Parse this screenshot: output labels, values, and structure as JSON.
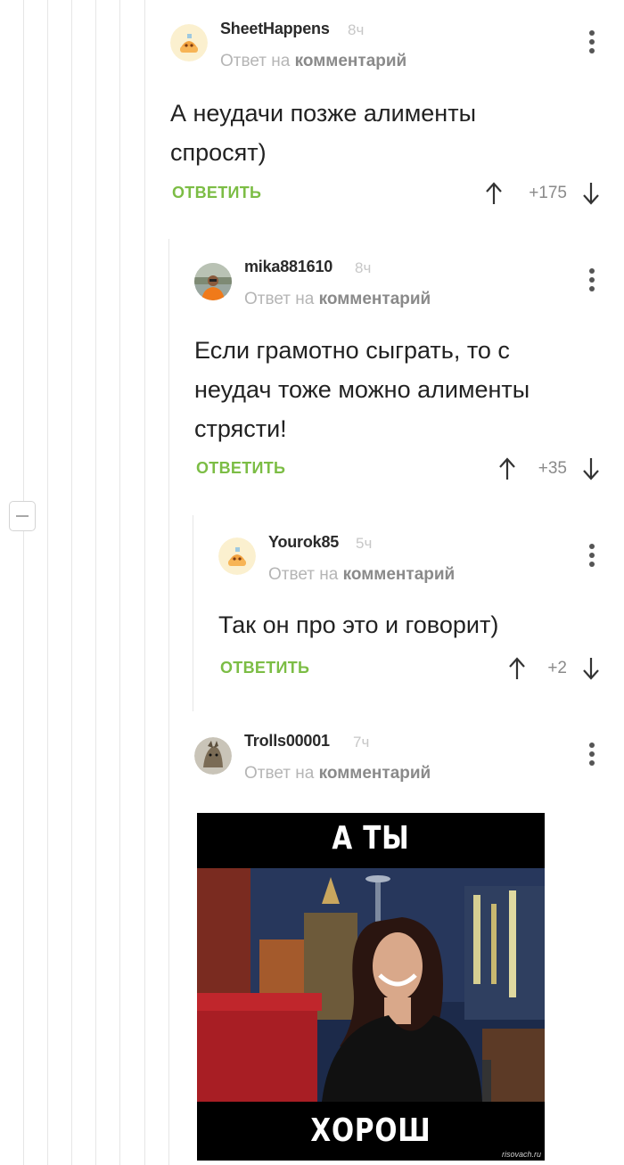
{
  "reply_label": "Ответ на",
  "reply_target": "комментарий",
  "reply_button": "ОТВЕТИТЬ",
  "colors": {
    "accent_green": "#7cbd45",
    "meta_gray": "#b5b5b5",
    "time_gray": "#c7c7c7"
  },
  "icons": {
    "upvote": "arrow-up-icon",
    "downvote": "arrow-down-icon",
    "menu": "more-vertical-icon",
    "collapse": "minus-square-icon"
  },
  "comments": [
    {
      "author": "SheetHappens",
      "time": "8ч",
      "text": "А неудачи позже алименты спросят)",
      "rating": "+175"
    },
    {
      "author": "mika881610",
      "time": "8ч",
      "text": "Если грамотно сыграть, то с неудач тоже можно алименты стрясти!",
      "rating": "+35"
    },
    {
      "author": "Yourok85",
      "time": "5ч",
      "text": "Так он про это и говорит)",
      "rating": "+2"
    },
    {
      "author": "Trolls00001",
      "time": "7ч",
      "text": "",
      "rating": ""
    }
  ],
  "meme": {
    "top_caption": "А ТЫ",
    "bottom_caption": "ХОРОШ",
    "watermark": "risovach.ru"
  }
}
